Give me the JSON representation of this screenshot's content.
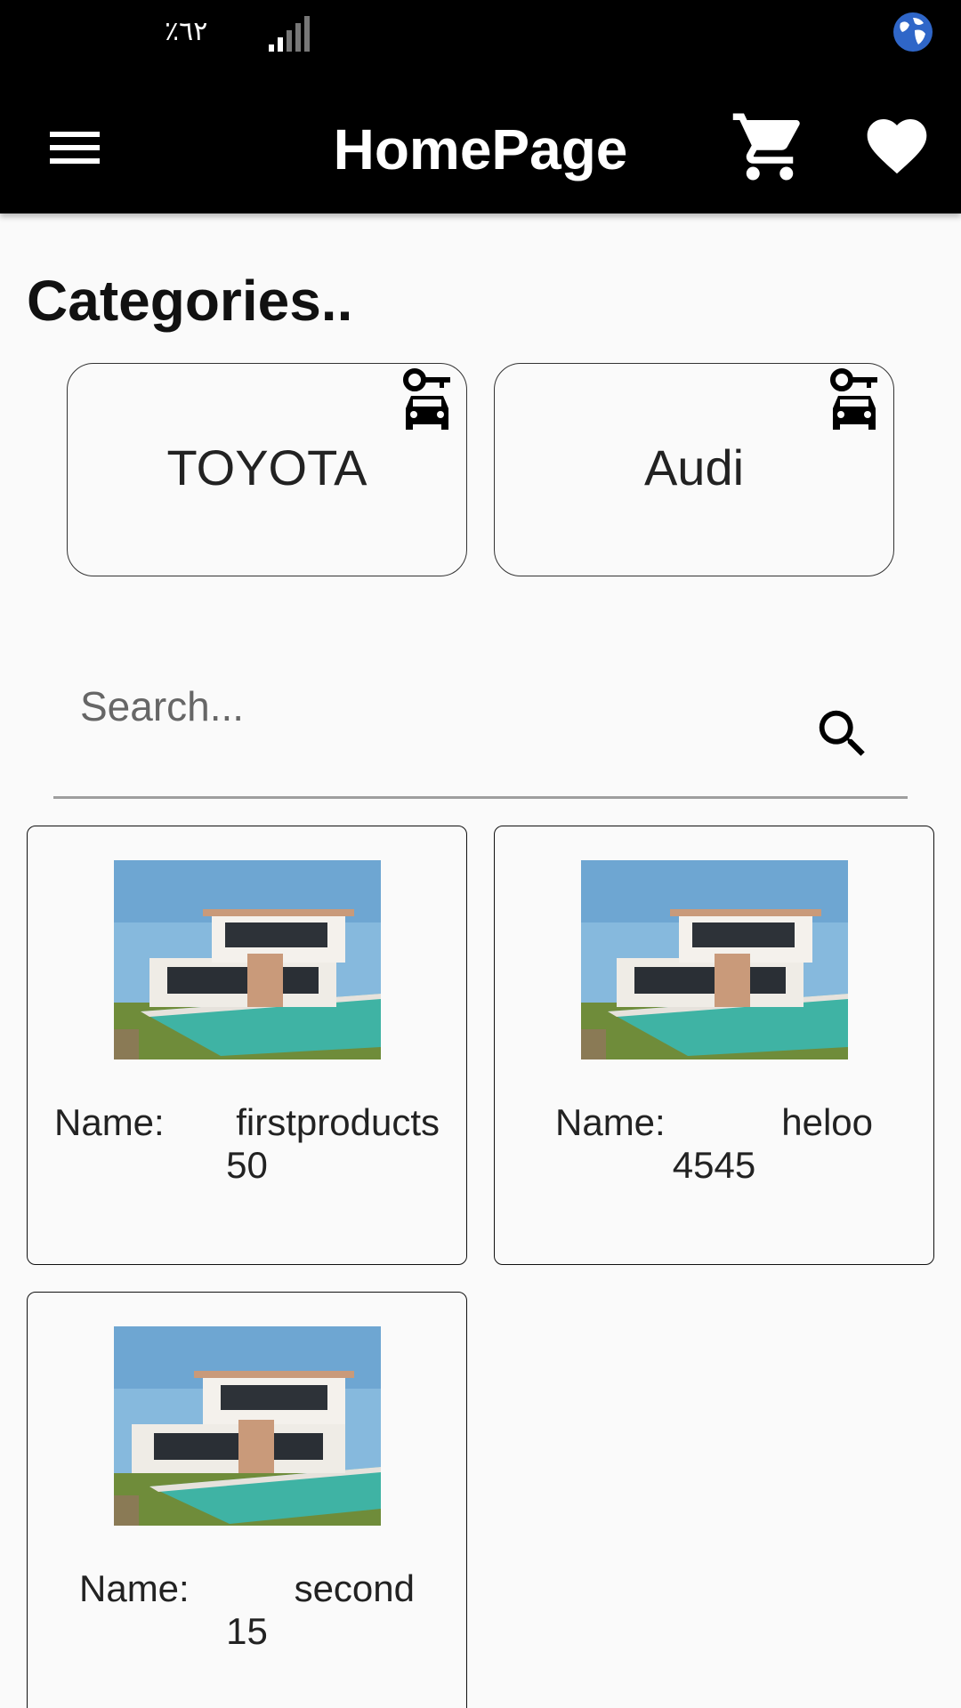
{
  "status_bar": {
    "battery_text": "٪٦٢",
    "signal_icon": "signal-icon",
    "globe_icon": "globe-icon"
  },
  "app_bar": {
    "title": "HomePage",
    "menu_icon": "menu-icon",
    "cart_icon": "cart-icon",
    "favorite_icon": "heart-icon"
  },
  "categories": {
    "title": "Categories..",
    "items": [
      {
        "label": "TOYOTA",
        "icon": "car-key-icon"
      },
      {
        "label": "Audi",
        "icon": "car-key-icon"
      }
    ]
  },
  "search": {
    "placeholder": "Search...",
    "icon": "search-icon"
  },
  "products": {
    "name_label": "Name:",
    "items": [
      {
        "name": "firstproducts",
        "price": "50"
      },
      {
        "name": "heloo",
        "price": "4545"
      },
      {
        "name": "second",
        "price": "15"
      }
    ]
  },
  "colors": {
    "app_bar": "#000000",
    "background": "#fafafa",
    "text": "#111111",
    "sky": "#7fb6dc",
    "pool": "#3fb3a4",
    "grass": "#6f8c3a"
  }
}
